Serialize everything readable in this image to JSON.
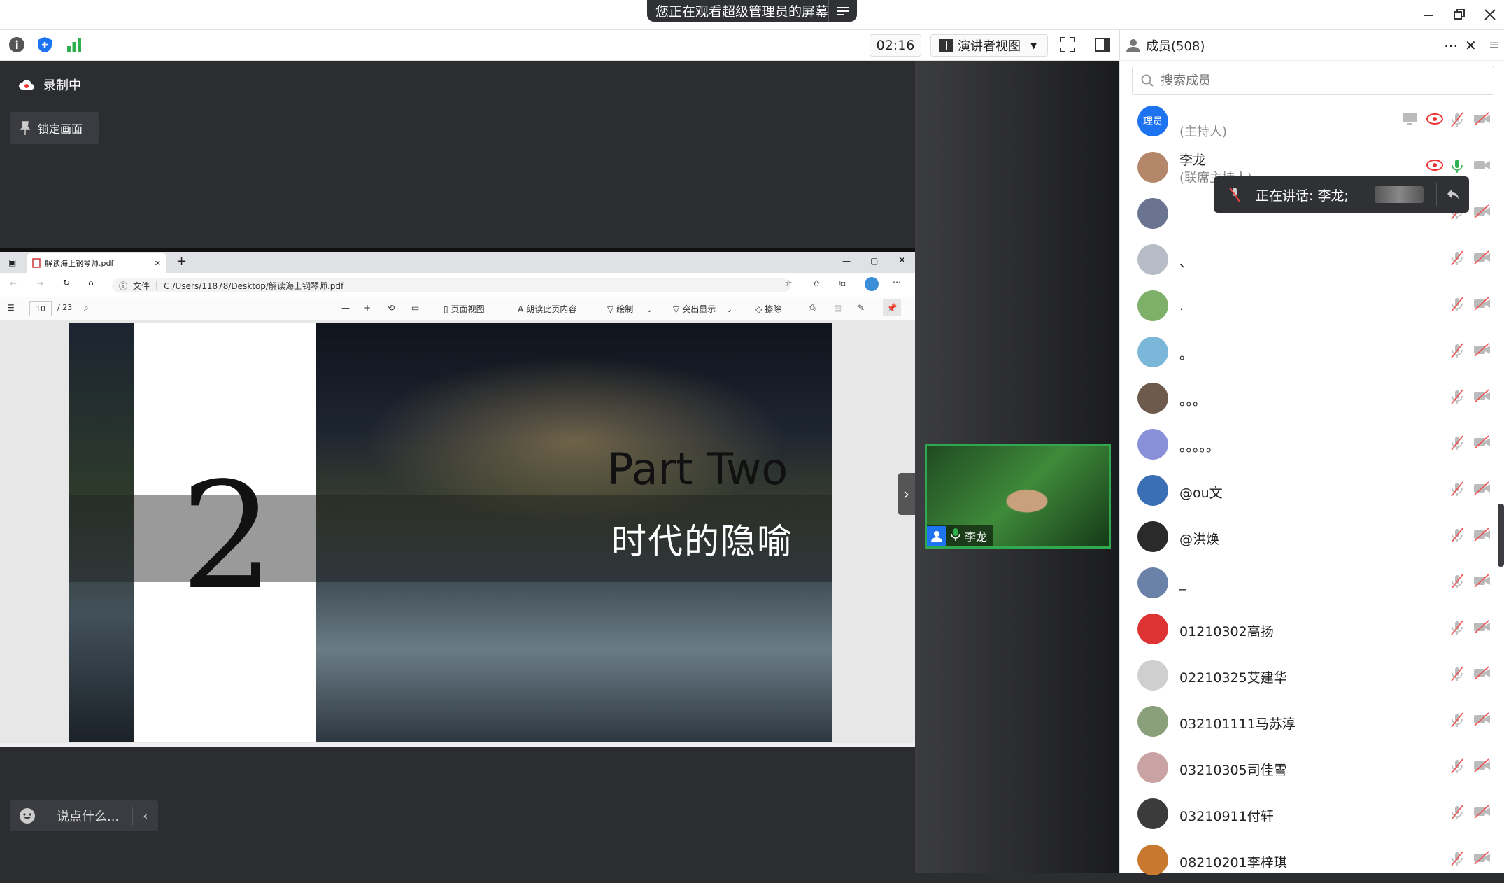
{
  "banner": {
    "text": "您正在观看超级管理员的屏幕"
  },
  "toolbar": {
    "timer": "02:16",
    "presenter_view": "演讲者视图"
  },
  "stage": {
    "recording": "录制中",
    "lock_screen": "锁定画面",
    "chat_placeholder": "说点什么..."
  },
  "pdf": {
    "tab_title": "解读海上钢琴师.pdf",
    "address_prefix": "文件",
    "address": "C:/Users/11878/Desktop/解读海上钢琴师.pdf",
    "page_current": "10",
    "page_total": "/ 23",
    "tools": {
      "page_view": "页面视图",
      "read_aloud": "朗读此页内容",
      "draw": "绘制",
      "highlight": "突出显示",
      "erase": "擦除"
    },
    "slide": {
      "number": "2",
      "title": "Part Two",
      "subtitle": "时代的隐喻"
    }
  },
  "video": {
    "name": "李龙"
  },
  "panel": {
    "title": "成员(508)",
    "search_placeholder": "搜索成员",
    "speaking": "正在讲话: 李龙;",
    "members": [
      {
        "name": "",
        "role": "(主持人)",
        "avatar_text": "理员",
        "color": "#1e74f0"
      },
      {
        "name": "李龙",
        "role": "(联席主持人)",
        "color": "#b4866a"
      },
      {
        "name": "",
        "color": "#6a7390"
      },
      {
        "name": "、",
        "color": "#b7bcc6"
      },
      {
        "name": ".",
        "color": "#7fb06a"
      },
      {
        "name": "。",
        "color": "#7bb7d8"
      },
      {
        "name": "。。。",
        "color": "#6d5a4d"
      },
      {
        "name": "。。。。。",
        "color": "#8a90d8"
      },
      {
        "name": "@ou文",
        "color": "#3b6fb5"
      },
      {
        "name": "@洪焕",
        "color": "#2a2a2a"
      },
      {
        "name": "_",
        "color": "#6a82a8"
      },
      {
        "name": "01210302高扬",
        "color": "#d33"
      },
      {
        "name": "02210325艾建华",
        "color": "#cfcfcf"
      },
      {
        "name": "032101111马苏淳",
        "color": "#8aa07a"
      },
      {
        "name": "03210305司佳雪",
        "color": "#c9a3a3"
      },
      {
        "name": "03210911付轩",
        "color": "#3b3b3b"
      },
      {
        "name": "08210201李梓琪",
        "color": "#c8782f"
      }
    ]
  }
}
